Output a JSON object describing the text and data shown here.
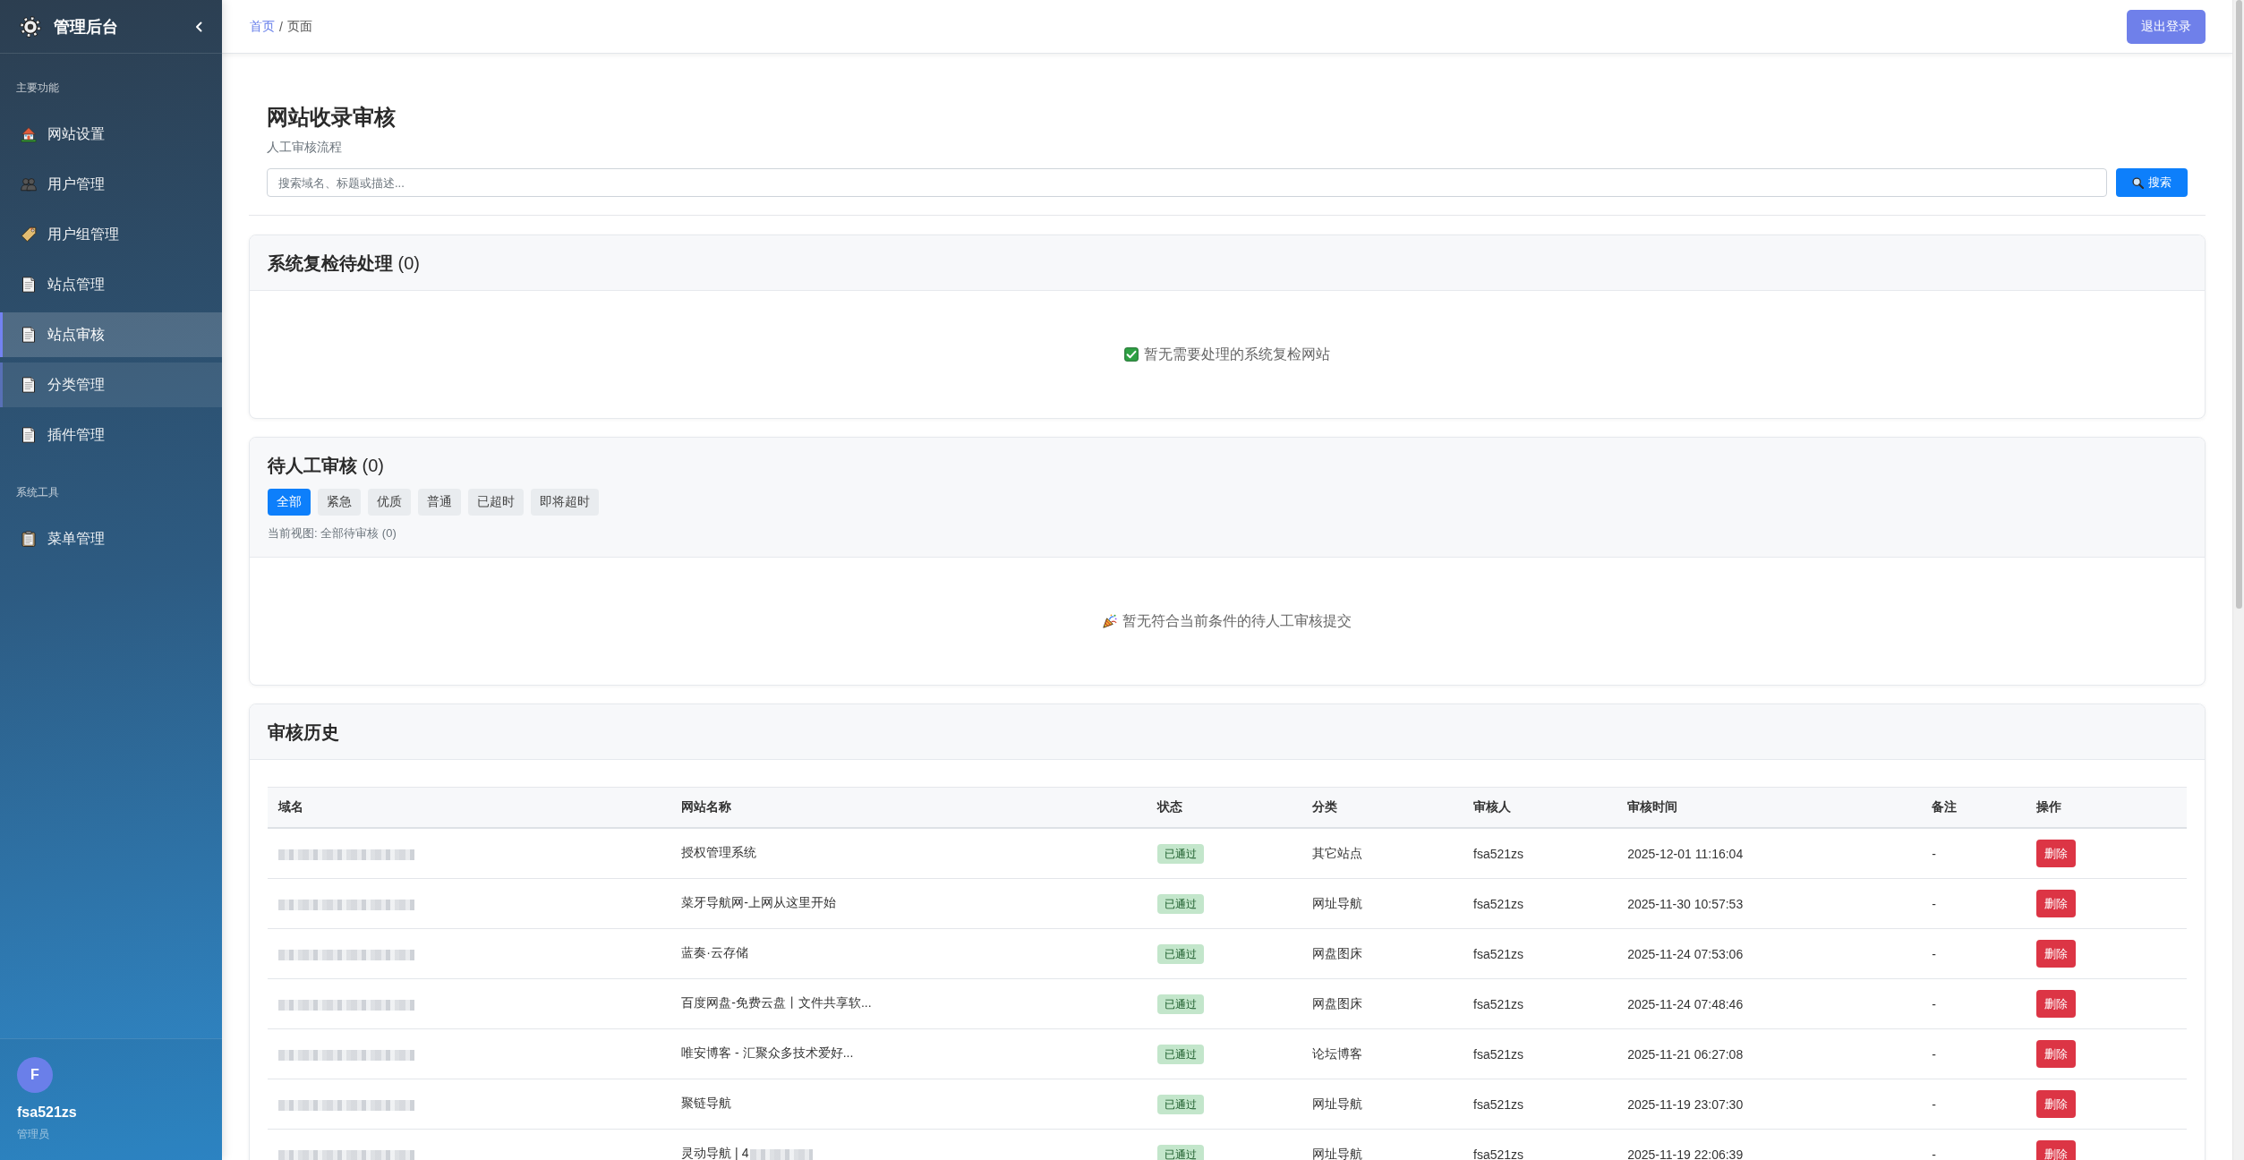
{
  "sidebar": {
    "brand": "管理后台",
    "sections": [
      {
        "label": "主要功能",
        "items": [
          {
            "label": "网站设置",
            "kind": "home",
            "selected": false,
            "hovered": false
          },
          {
            "label": "用户管理",
            "kind": "users",
            "selected": false,
            "hovered": false
          },
          {
            "label": "用户组管理",
            "kind": "tag",
            "selected": false,
            "hovered": false
          },
          {
            "label": "站点管理",
            "kind": "page",
            "selected": false,
            "hovered": false
          },
          {
            "label": "站点审核",
            "kind": "page",
            "selected": true,
            "hovered": false
          },
          {
            "label": "分类管理",
            "kind": "page",
            "selected": false,
            "hovered": true
          },
          {
            "label": "插件管理",
            "kind": "page",
            "selected": false,
            "hovered": false
          }
        ]
      },
      {
        "label": "系统工具",
        "items": [
          {
            "label": "菜单管理",
            "kind": "clipboard",
            "selected": false,
            "hovered": false
          }
        ]
      }
    ],
    "user": {
      "initial": "F",
      "name": "fsa521zs",
      "role": "管理员"
    }
  },
  "topbar": {
    "breadcrumb": {
      "home": "首页",
      "separator": "/",
      "current": "页面"
    },
    "logout": "退出登录"
  },
  "page_header": {
    "title": "网站收录审核",
    "subtitle": "人工审核流程",
    "search": {
      "placeholder": "搜索域名、标题或描述...",
      "button": "搜索"
    }
  },
  "recheck": {
    "title": "系统复检待处理",
    "count": "(0)",
    "empty": {
      "kind": "check",
      "text": "暂无需要处理的系统复检网站"
    }
  },
  "manual_review": {
    "title": "待人工审核",
    "count": "(0)",
    "filters": [
      {
        "label": "全部",
        "selected": true
      },
      {
        "label": "紧急",
        "selected": false
      },
      {
        "label": "优质",
        "selected": false
      },
      {
        "label": "普通",
        "selected": false
      },
      {
        "label": "已超时",
        "selected": false
      },
      {
        "label": "即将超时",
        "selected": false
      }
    ],
    "current_view": "当前视图: 全部待审核 (0)",
    "empty": {
      "kind": "party",
      "text": "暂无符合当前条件的待人工审核提交"
    }
  },
  "history": {
    "title": "审核历史",
    "columns": [
      "域名",
      "网站名称",
      "状态",
      "分类",
      "审核人",
      "审核时间",
      "备注",
      "操作"
    ],
    "rows": [
      {
        "name": "授权管理系统",
        "name_tail_blurred": false,
        "status": "已通过",
        "category": "其它站点",
        "reviewer": "fsa521zs",
        "time": "2025-12-01 11:16:04",
        "note": "-",
        "action": "删除"
      },
      {
        "name": "菜牙导航网-上网从这里开始",
        "name_tail_blurred": false,
        "status": "已通过",
        "category": "网址导航",
        "reviewer": "fsa521zs",
        "time": "2025-11-30 10:57:53",
        "note": "-",
        "action": "删除"
      },
      {
        "name": "蓝奏·云存储",
        "name_tail_blurred": false,
        "status": "已通过",
        "category": "网盘图床",
        "reviewer": "fsa521zs",
        "time": "2025-11-24 07:53:06",
        "note": "-",
        "action": "删除"
      },
      {
        "name": "百度网盘-免费云盘丨文件共享软...",
        "name_tail_blurred": false,
        "status": "已通过",
        "category": "网盘图床",
        "reviewer": "fsa521zs",
        "time": "2025-11-24 07:48:46",
        "note": "-",
        "action": "删除"
      },
      {
        "name": "唯安博客 - 汇聚众多技术爱好...",
        "name_tail_blurred": false,
        "status": "已通过",
        "category": "论坛博客",
        "reviewer": "fsa521zs",
        "time": "2025-11-21 06:27:08",
        "note": "-",
        "action": "删除"
      },
      {
        "name": "聚链导航",
        "name_tail_blurred": false,
        "status": "已通过",
        "category": "网址导航",
        "reviewer": "fsa521zs",
        "time": "2025-11-19 23:07:30",
        "note": "-",
        "action": "删除"
      },
      {
        "name": "灵动导航 | 4",
        "name_tail_blurred": true,
        "status": "已通过",
        "category": "网址导航",
        "reviewer": "fsa521zs",
        "time": "2025-11-19 22:06:39",
        "note": "-",
        "action": "删除"
      }
    ]
  }
}
